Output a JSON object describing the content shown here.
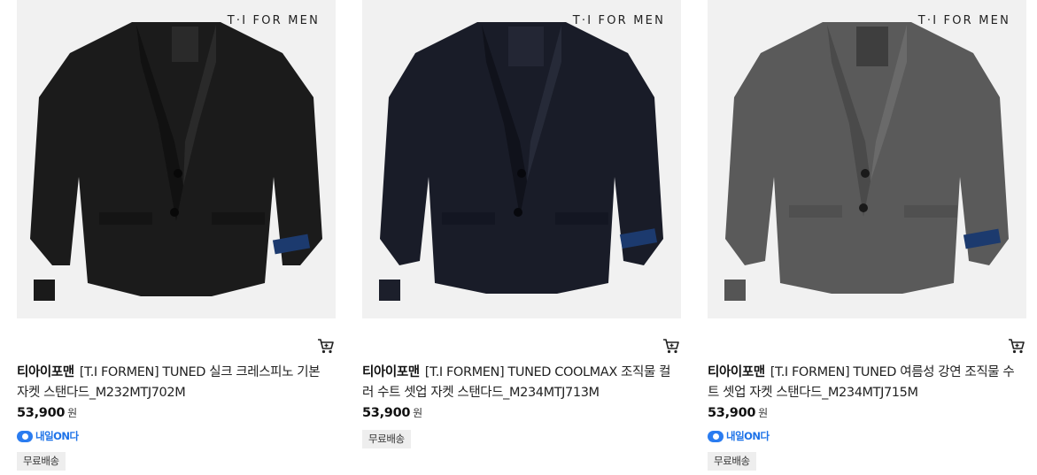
{
  "products": [
    {
      "logo": "T·I FOR MEN",
      "brand": "티아이포맨",
      "name": "[T.I FORMEN] TUNED 실크 크레스피노 기본 자켓 스탠다드_M232MTJ702M",
      "price": "53,900",
      "currency": "원",
      "delivery_badge": "내일ON다",
      "shipping": "무료배송",
      "swatch_color": "#1a1a1a",
      "jacket_color": "#1b1b1b",
      "cart_icon": "cart-icon"
    },
    {
      "logo": "T·I FOR MEN",
      "brand": "티아이포맨",
      "name": "[T.I FORMEN] TUNED COOLMAX 조직물 컬러 수트 셋업 자켓 스탠다드_M234MTJ713M",
      "price": "53,900",
      "currency": "원",
      "delivery_badge": "",
      "shipping": "무료배송",
      "swatch_color": "#1c1f2b",
      "jacket_color": "#191c28",
      "cart_icon": "cart-icon"
    },
    {
      "logo": "T·I FOR MEN",
      "brand": "티아이포맨",
      "name": "[T.I FORMEN] TUNED 여름성 강연 조직물 수트 셋업 자켓 스탠다드_M234MTJ715M",
      "price": "53,900",
      "currency": "원",
      "delivery_badge": "내일ON다",
      "shipping": "무료배송",
      "swatch_color": "#555555",
      "jacket_color": "#5a5a5a",
      "cart_icon": "cart-icon"
    }
  ]
}
